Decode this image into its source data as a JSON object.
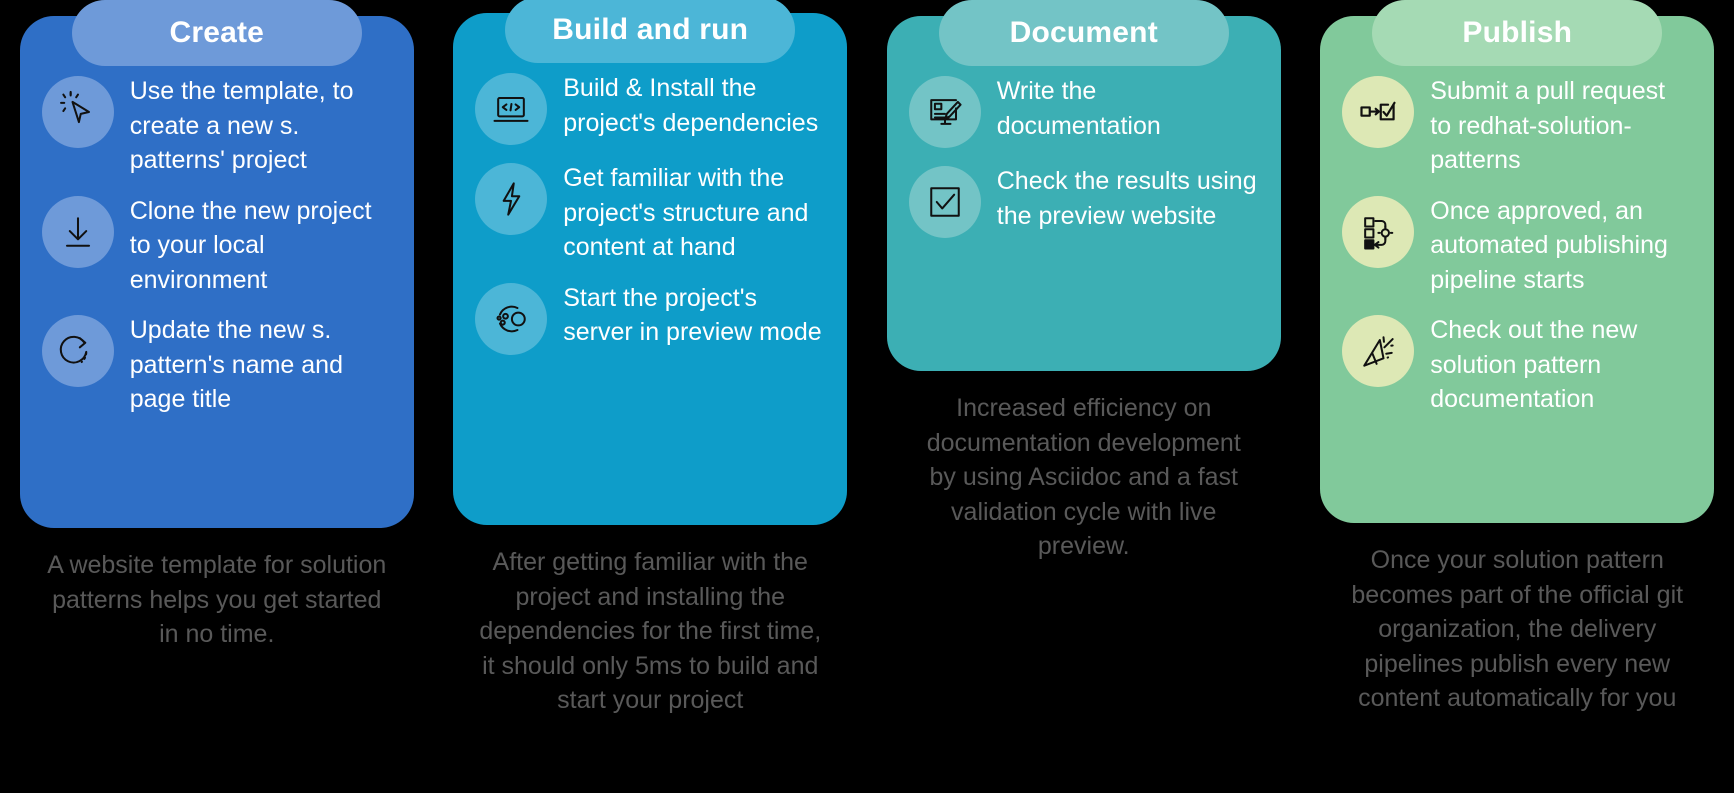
{
  "columns": [
    {
      "id": "create",
      "title": "Create",
      "header_color": "#6e9ad9",
      "body_color": "#2f6fc6",
      "steps": [
        {
          "icon": "cursor-click-icon",
          "text": "Use the template, to create a new s. patterns' project"
        },
        {
          "icon": "download-arrow-icon",
          "text": "Clone the new project to your local environment"
        },
        {
          "icon": "refresh-circle-icon",
          "text": "Update the new  s. pattern's name and page title"
        }
      ],
      "caption": "A website template for solution patterns helps you get started in no time."
    },
    {
      "id": "build-and-run",
      "title": "Build and run",
      "header_color": "#4cb6d7",
      "body_color": "#0e9dc9",
      "steps": [
        {
          "icon": "code-laptop-icon",
          "text": "Build & Install the project's dependencies"
        },
        {
          "icon": "lightning-bolt-icon",
          "text": "Get familiar with the project's structure and content at hand"
        },
        {
          "icon": "atom-particles-icon",
          "text": "Start the project's server in preview mode"
        }
      ],
      "caption": "After getting familiar with the project and installing the dependencies for the first time, it should only 5ms to build and start your project"
    },
    {
      "id": "document",
      "title": "Document",
      "header_color": "#73c4c6",
      "body_color": "#3cafb4",
      "steps": [
        {
          "icon": "monitor-pencil-icon",
          "text": "Write the documentation"
        },
        {
          "icon": "checkbox-check-icon",
          "text": "Check the results using the preview website"
        }
      ],
      "caption": "Increased efficiency on documentation development by using Asciidoc and a fast validation cycle with live preview."
    },
    {
      "id": "publish",
      "title": "Publish",
      "header_color": "#a5dab4",
      "body_color": "#81c99b",
      "steps": [
        {
          "icon": "pull-request-check-icon",
          "text": "Submit a pull request to redhat-solution-patterns"
        },
        {
          "icon": "automation-pipeline-icon",
          "text": "Once approved, an automated publishing pipeline starts"
        },
        {
          "icon": "party-popper-icon",
          "text": "Check out the new solution pattern documentation"
        }
      ],
      "caption": "Once your solution pattern becomes part of the official git organization, the delivery pipelines publish every new content automatically for you"
    }
  ],
  "background_color": "#000000",
  "caption_color": "#595959",
  "step_text_color": "#ffffff"
}
